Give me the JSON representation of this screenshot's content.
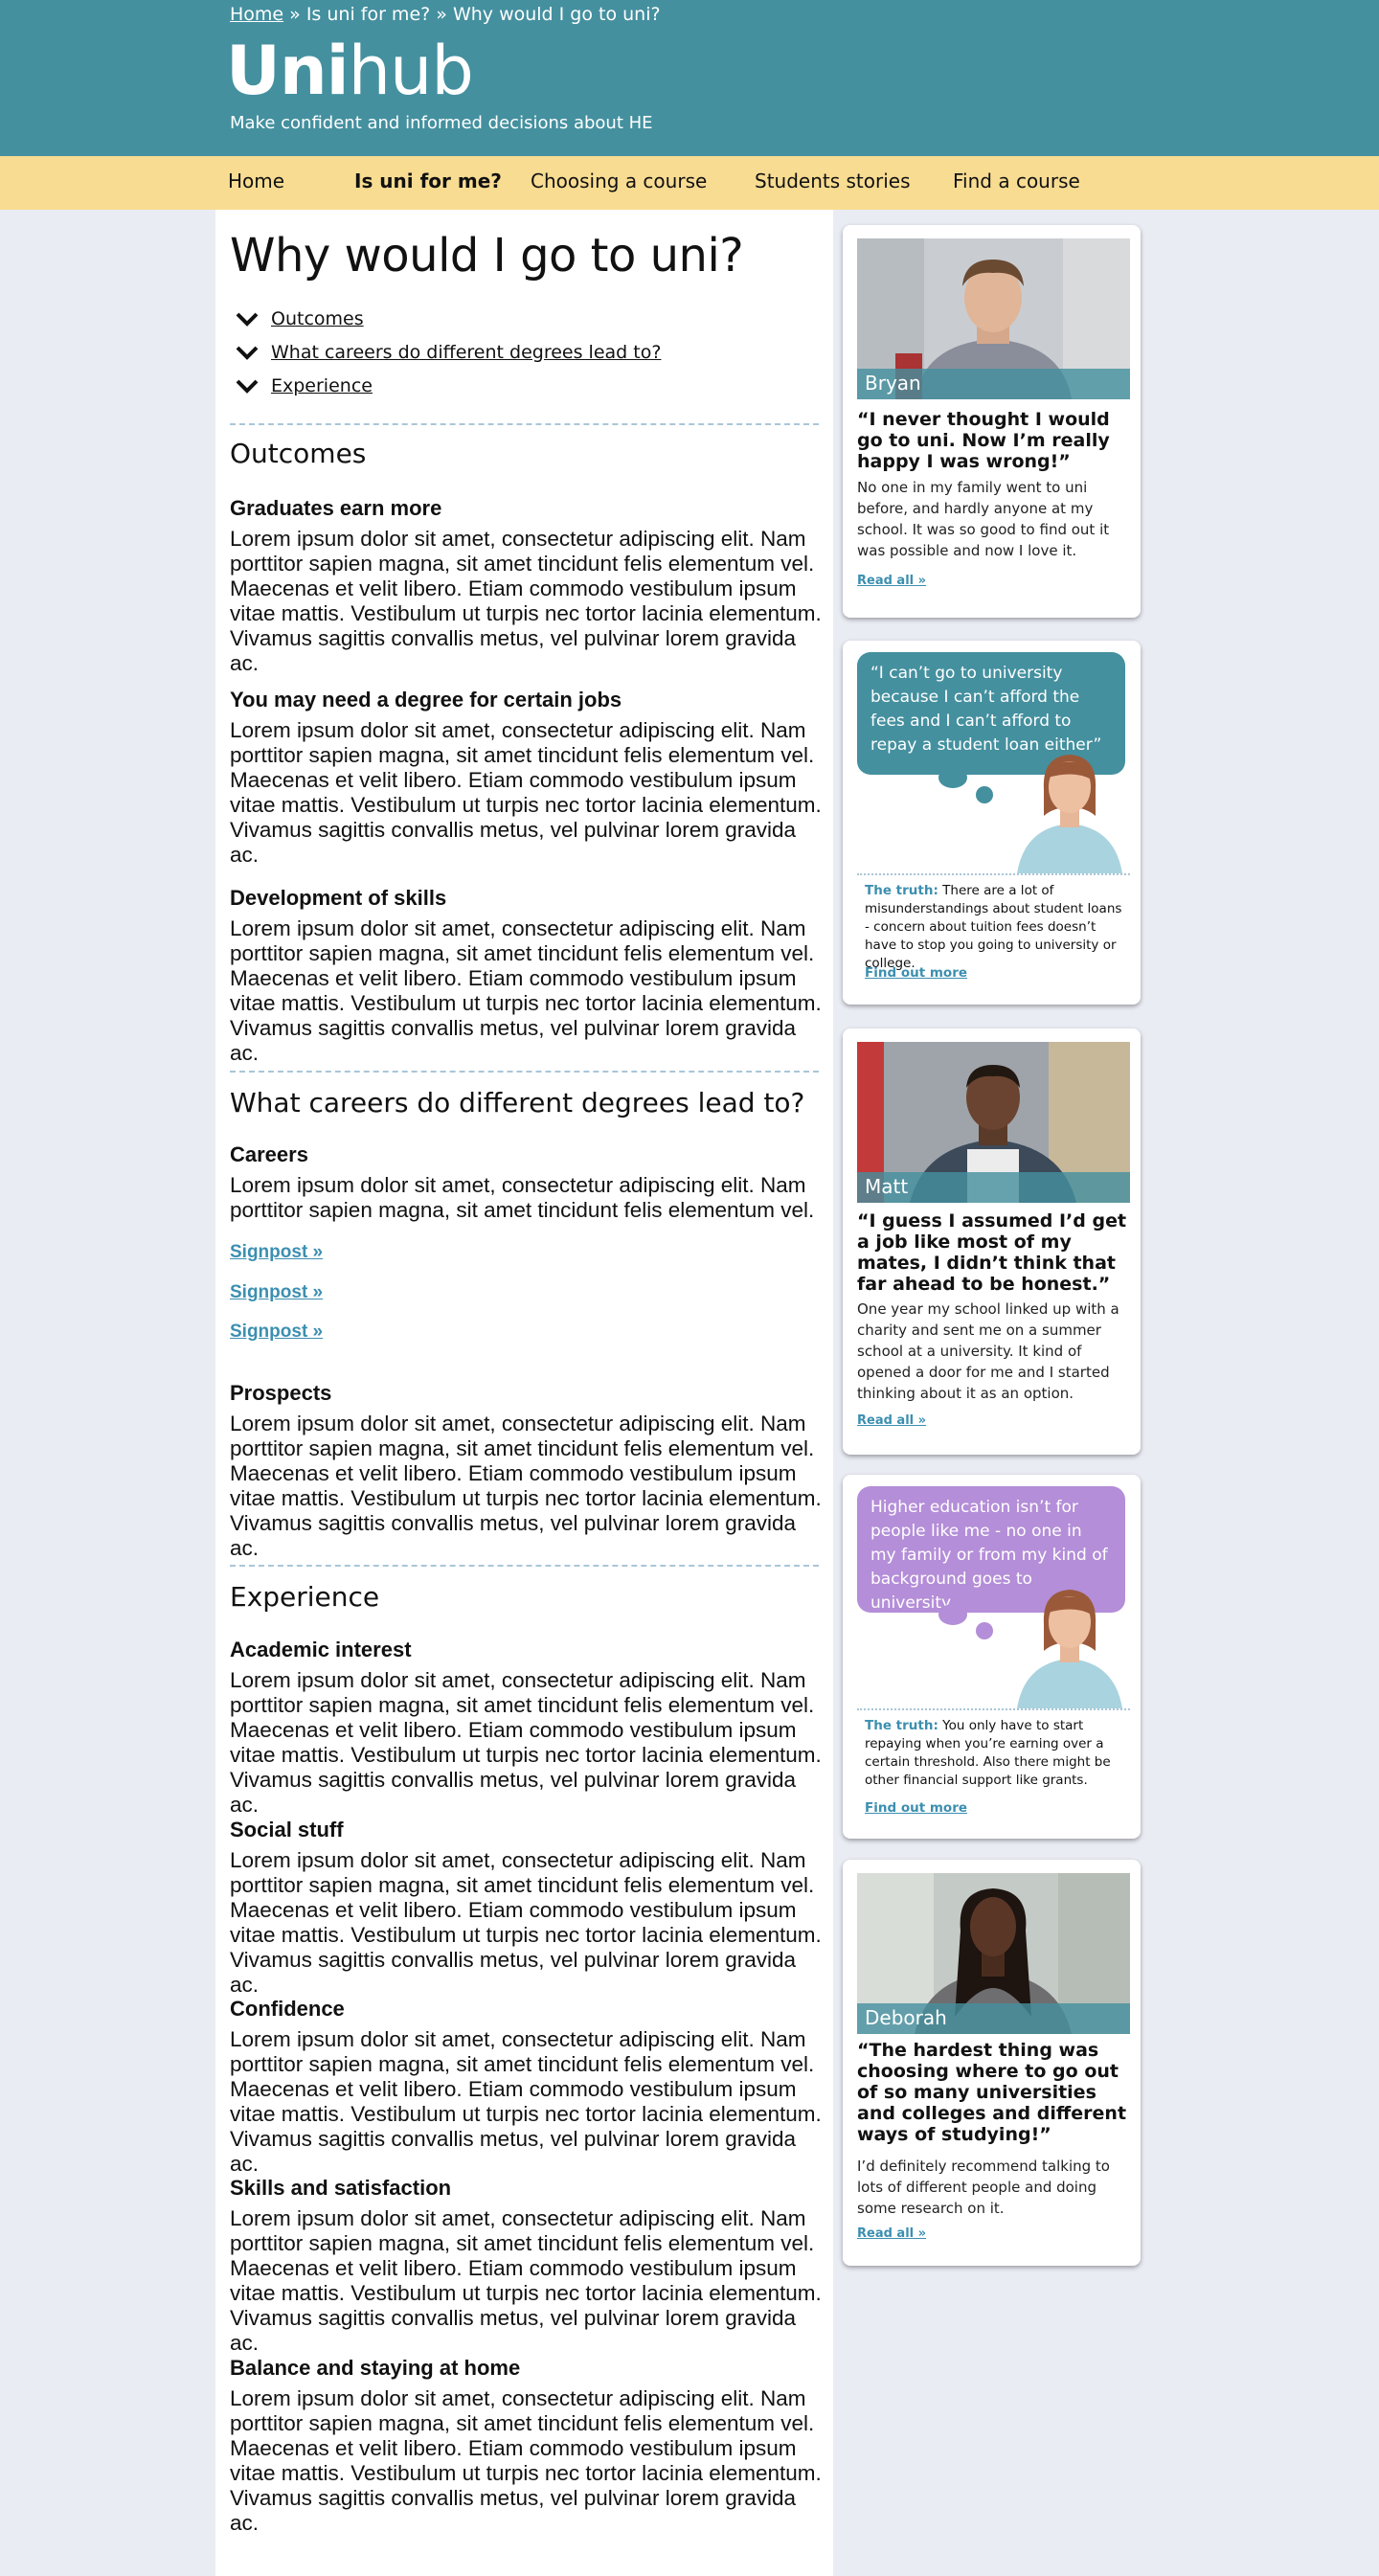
{
  "header": {
    "breadcrumb": {
      "home": "Home",
      "sep1": " » ",
      "level2": "Is uni for me?",
      "sep2": " » ",
      "current": "Why would I go to uni?"
    },
    "logo": {
      "bold": "Uni",
      "light": "hub"
    },
    "tagline": "Make confident and informed decisions about HE"
  },
  "nav": {
    "items": [
      "Home",
      "Is uni for me?",
      "Choosing a course",
      "Students stories",
      "Find a course"
    ],
    "active": "Is uni for me?"
  },
  "main": {
    "title": "Why would I go to uni?",
    "toc": [
      "Outcomes",
      "What careers do different degrees lead to?",
      "Experience"
    ],
    "lorem_long": "Lorem ipsum dolor sit amet, consectetur adipiscing elit. Nam porttitor sapien magna, sit amet tincidunt felis elementum vel. Maecenas et velit libero. Etiam commodo vestibulum ipsum vitae mattis. Vestibulum ut turpis nec tortor lacinia elementum. Vivamus sagittis convallis metus, vel pulvinar lorem gravida ac.",
    "lorem_short": "Lorem ipsum dolor sit amet, consectetur adipiscing elit. Nam porttitor sapien magna, sit amet tincidunt felis elementum vel.",
    "outcomes": {
      "title": "Outcomes",
      "subs": [
        "Graduates earn more",
        "You may need a degree for certain jobs",
        "Development of skills"
      ]
    },
    "careers": {
      "title": "What careers do different degrees lead to?",
      "careers_sub": "Careers",
      "signposts": [
        "Signpost »",
        "Signpost »",
        "Signpost »"
      ],
      "prospects_sub": "Prospects"
    },
    "experience": {
      "title": "Experience",
      "subs": [
        "Academic interest",
        "Social stuff",
        "Confidence",
        "Skills and satisfaction",
        "Balance and staying at home"
      ]
    }
  },
  "sidebar": {
    "bryan": {
      "name": "Bryan",
      "quote": "“I never thought I would go to uni. Now I’m really happy I was wrong!”",
      "story": "No one in my family went to uni before, and hardly anyone at my school. It was so good to find out it was possible and now I love it.",
      "link": "Read all »"
    },
    "myth1": {
      "bubble": "“I can’t go to university because I can’t afford the fees and I can’t afford to repay a student loan either”",
      "truth_label": "The truth:",
      "truth": " There are a lot of misunderstandings about student loans - concern about tuition fees doesn’t have to stop you going to university or college.",
      "link": "Find out more",
      "color": "#44909f"
    },
    "matt": {
      "name": "Matt",
      "quote": "“I guess I assumed I’d get a job like most of my mates, I didn’t think that far ahead to be honest.”",
      "story": "One year my school linked up with a charity and sent me on a summer school at a university. It kind of opened a door for me and I started thinking about it as an option.",
      "link": "Read all »"
    },
    "myth2": {
      "bubble": "Higher education isn’t for people like me - no one in my family or from my kind of background goes to university",
      "truth_label": "The truth:",
      "truth": "  You only have to start repaying when you’re earning over a certain threshold. Also there might be other financial support like grants.",
      "link": "Find out more",
      "color": "#b48ed8"
    },
    "deborah": {
      "name": "Deborah",
      "quote": "“The hardest thing was choosing where to go out of so many universities and colleges and different ways of studying!”",
      "story": "I’d definitely recommend talking to lots of different people and doing some research on it.",
      "link": "Read all »"
    }
  }
}
